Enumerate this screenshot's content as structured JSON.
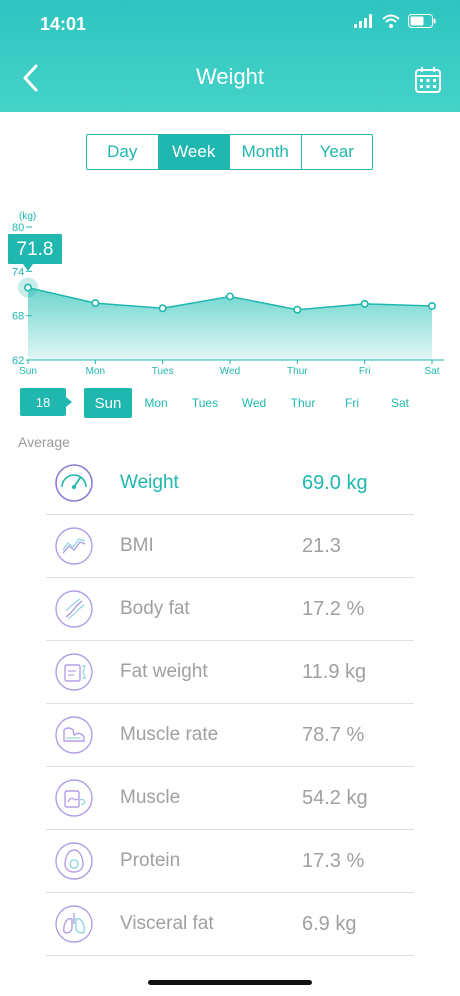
{
  "status": {
    "time": "14:01"
  },
  "header": {
    "title": "Weight"
  },
  "segments": [
    {
      "label": "Day",
      "active": false
    },
    {
      "label": "Week",
      "active": true
    },
    {
      "label": "Month",
      "active": false
    },
    {
      "label": "Year",
      "active": false
    }
  ],
  "chart_data": {
    "type": "area",
    "ylabel": "(kg)",
    "ylim": [
      62,
      80
    ],
    "yticks": [
      "62",
      "68",
      "74",
      "80"
    ],
    "categories": [
      "Sun",
      "Mon",
      "Tues",
      "Wed",
      "Thur",
      "Fri",
      "Sat"
    ],
    "values": [
      71.8,
      69.7,
      69.0,
      70.6,
      68.8,
      69.6,
      69.3
    ],
    "selected_index": 0,
    "selected_label": "71.8",
    "colors": {
      "line": "#1fb7ae",
      "fill": "#3cc7bd"
    }
  },
  "day_strip": {
    "date": "18",
    "days": [
      "Sun",
      "Mon",
      "Tues",
      "Wed",
      "Thur",
      "Fri",
      "Sat"
    ],
    "active_index": 0
  },
  "average_label": "Average",
  "metrics": [
    {
      "icon": "gauge-icon",
      "name": "Weight",
      "value": "69.0 kg",
      "active": true
    },
    {
      "icon": "bmi-trend-icon",
      "name": "BMI",
      "value": "21.3",
      "active": false
    },
    {
      "icon": "dna-icon",
      "name": "Body fat",
      "value": "17.2 %",
      "active": false
    },
    {
      "icon": "scale-icon",
      "name": "Fat weight",
      "value": "11.9 kg",
      "active": false
    },
    {
      "icon": "muscle-arm-icon",
      "name": "Muscle rate",
      "value": "78.7 %",
      "active": false
    },
    {
      "icon": "muscle-scale-icon",
      "name": "Muscle",
      "value": "54.2 kg",
      "active": false
    },
    {
      "icon": "egg-icon",
      "name": "Protein",
      "value": "17.3 %",
      "active": false
    },
    {
      "icon": "lungs-icon",
      "name": "Visceral fat",
      "value": "6.9 kg",
      "active": false
    }
  ],
  "colors": {
    "accent": "#1fb7ae",
    "header_top": "#2ec4c0",
    "header_bottom": "#45d3c8",
    "icon_outline": "#b39ee6"
  }
}
